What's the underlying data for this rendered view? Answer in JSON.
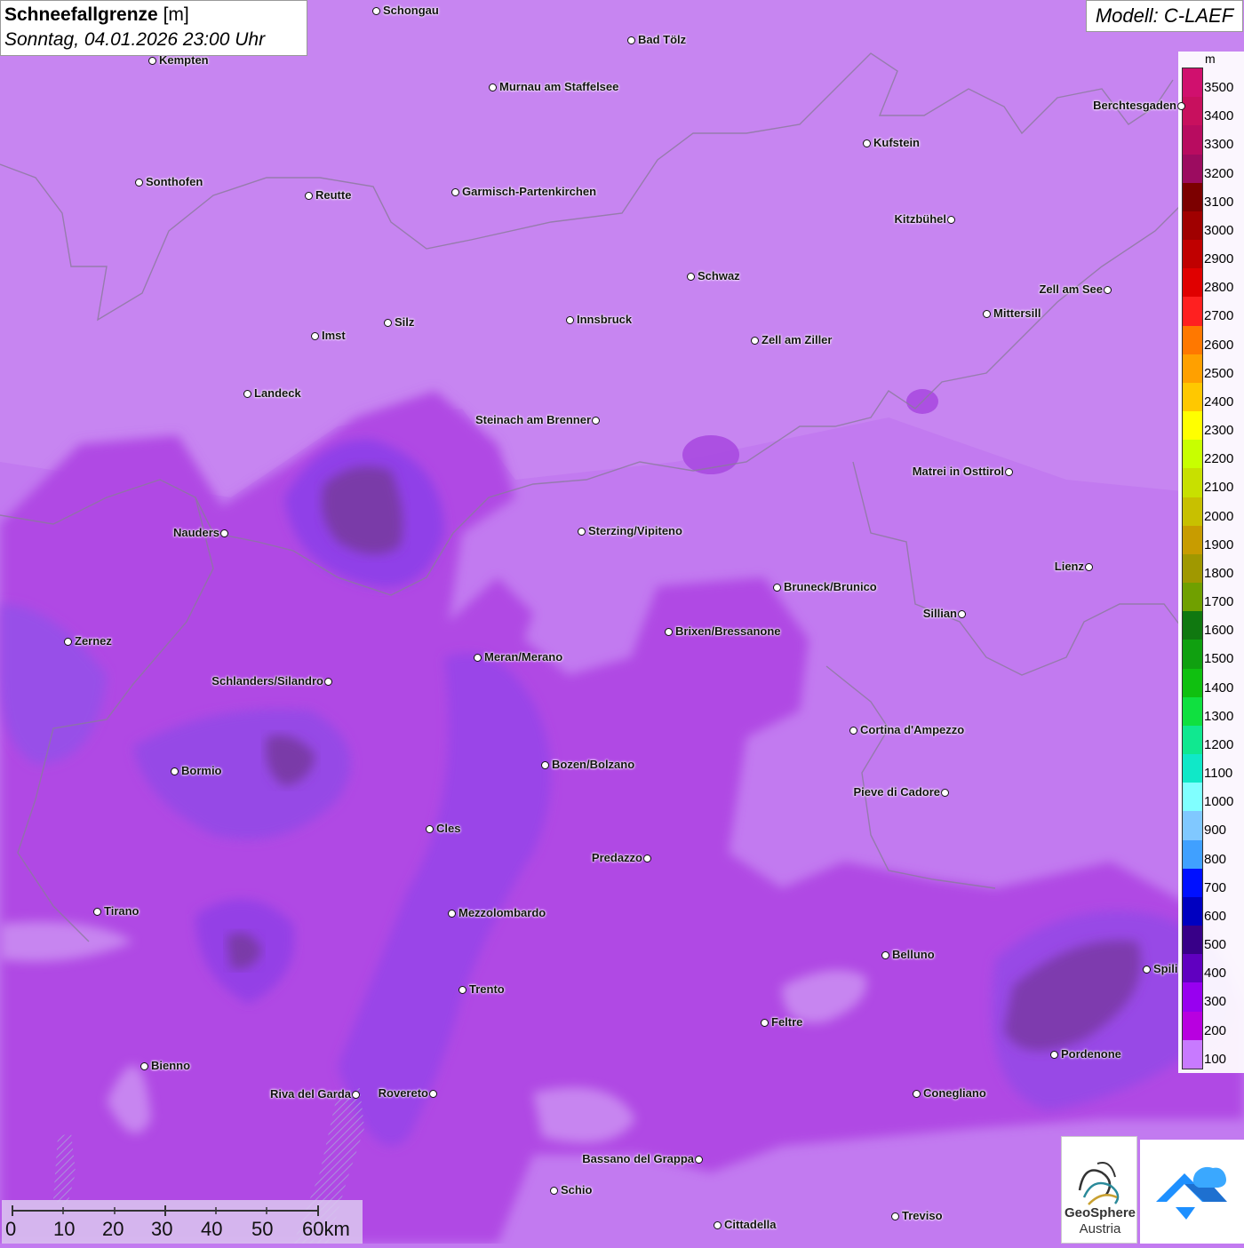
{
  "header": {
    "title_bold": "Schneefallgrenze",
    "title_unit": " [m]",
    "timestamp": "Sonntag, 04.01.2026 23:00 Uhr",
    "model": "Modell: C-LAEF"
  },
  "legend": {
    "unit": "m",
    "steps": [
      {
        "label": "3500",
        "color": "#d0106e"
      },
      {
        "label": "3400",
        "color": "#c8105e"
      },
      {
        "label": "3300",
        "color": "#b80c60"
      },
      {
        "label": "3200",
        "color": "#9c0c60"
      },
      {
        "label": "3100",
        "color": "#7c0000"
      },
      {
        "label": "3000",
        "color": "#a00000"
      },
      {
        "label": "2900",
        "color": "#c00000"
      },
      {
        "label": "2800",
        "color": "#e00000"
      },
      {
        "label": "2700",
        "color": "#ff2020"
      },
      {
        "label": "2600",
        "color": "#ff7800"
      },
      {
        "label": "2500",
        "color": "#ffa000"
      },
      {
        "label": "2400",
        "color": "#ffc800"
      },
      {
        "label": "2300",
        "color": "#ffff00"
      },
      {
        "label": "2200",
        "color": "#c8ff00"
      },
      {
        "label": "2100",
        "color": "#c8e000"
      },
      {
        "label": "2000",
        "color": "#c8c000"
      },
      {
        "label": "1900",
        "color": "#c89c00"
      },
      {
        "label": "1800",
        "color": "#a09800"
      },
      {
        "label": "1700",
        "color": "#70a000"
      },
      {
        "label": "1600",
        "color": "#107810"
      },
      {
        "label": "1500",
        "color": "#10a010"
      },
      {
        "label": "1400",
        "color": "#10c010"
      },
      {
        "label": "1300",
        "color": "#10e040"
      },
      {
        "label": "1200",
        "color": "#10e890"
      },
      {
        "label": "1100",
        "color": "#10e8c8"
      },
      {
        "label": "1000",
        "color": "#80ffff"
      },
      {
        "label": "900",
        "color": "#80c8ff"
      },
      {
        "label": "800",
        "color": "#40a0ff"
      },
      {
        "label": "700",
        "color": "#0010ff"
      },
      {
        "label": "600",
        "color": "#0000c0"
      },
      {
        "label": "500",
        "color": "#380088"
      },
      {
        "label": "400",
        "color": "#6000c0"
      },
      {
        "label": "300",
        "color": "#9800f0"
      },
      {
        "label": "200",
        "color": "#b800e0"
      },
      {
        "label": "100",
        "color": "#c87aff"
      }
    ]
  },
  "cities": [
    {
      "name": "Schongau",
      "side": "right"
    },
    {
      "name": "Bad Tölz",
      "side": "right"
    },
    {
      "name": "Kempten",
      "side": "right"
    },
    {
      "name": "Murnau am Staffelsee",
      "side": "right"
    },
    {
      "name": "Berchtesgaden",
      "side": "left"
    },
    {
      "name": "Kufstein",
      "side": "right"
    },
    {
      "name": "Sonthofen",
      "side": "right"
    },
    {
      "name": "Reutte",
      "side": "right"
    },
    {
      "name": "Garmisch-Partenkirchen",
      "side": "right"
    },
    {
      "name": "Kitzbühel",
      "side": "left"
    },
    {
      "name": "Schwaz",
      "side": "right"
    },
    {
      "name": "Zell am See",
      "side": "left"
    },
    {
      "name": "Mittersill",
      "side": "right"
    },
    {
      "name": "Innsbruck",
      "side": "right"
    },
    {
      "name": "Imst",
      "side": "right"
    },
    {
      "name": "Silz",
      "side": "right"
    },
    {
      "name": "Zell am Ziller",
      "side": "right"
    },
    {
      "name": "Landeck",
      "side": "right"
    },
    {
      "name": "Steinach am Brenner",
      "side": "left"
    },
    {
      "name": "Matrei in Osttirol",
      "side": "left"
    },
    {
      "name": "Nauders",
      "side": "left"
    },
    {
      "name": "Sterzing/Vipiteno",
      "side": "right"
    },
    {
      "name": "Lienz",
      "side": "left"
    },
    {
      "name": "Bruneck/Brunico",
      "side": "right"
    },
    {
      "name": "Sillian",
      "side": "left"
    },
    {
      "name": "Zernez",
      "side": "right"
    },
    {
      "name": "Brixen/Bressanone",
      "side": "right"
    },
    {
      "name": "Meran/Merano",
      "side": "right"
    },
    {
      "name": "Schlanders/Silandro",
      "side": "left"
    },
    {
      "name": "Cortina d'Ampezzo",
      "side": "right"
    },
    {
      "name": "Bozen/Bolzano",
      "side": "right"
    },
    {
      "name": "Bormio",
      "side": "right"
    },
    {
      "name": "Pieve di Cadore",
      "side": "left"
    },
    {
      "name": "Cles",
      "side": "right"
    },
    {
      "name": "Predazzo",
      "side": "left"
    },
    {
      "name": "Tirano",
      "side": "right"
    },
    {
      "name": "Mezzolombardo",
      "side": "right"
    },
    {
      "name": "Belluno",
      "side": "right"
    },
    {
      "name": "Spili",
      "side": "right"
    },
    {
      "name": "Trento",
      "side": "right"
    },
    {
      "name": "Feltre",
      "side": "right"
    },
    {
      "name": "Pordenone",
      "side": "right"
    },
    {
      "name": "Bienno",
      "side": "right"
    },
    {
      "name": "Riva del Garda",
      "side": "left"
    },
    {
      "name": "Rovereto",
      "side": "left"
    },
    {
      "name": "Conegliano",
      "side": "right"
    },
    {
      "name": "Bassano del Grappa",
      "side": "left"
    },
    {
      "name": "Schio",
      "side": "right"
    },
    {
      "name": "Treviso",
      "side": "right"
    },
    {
      "name": "Cittadella",
      "side": "right"
    }
  ],
  "scale": {
    "ticks": [
      "0",
      "10",
      "20",
      "30",
      "40",
      "50",
      "60km"
    ]
  },
  "logos": {
    "org_line1": "GeoSphere",
    "org_line2": "Austria"
  },
  "colors": {
    "base": "#c27af0",
    "mid": "#b452e6",
    "deep": "#9a3cdc",
    "darkest": "#7a38b8",
    "light": "#cc8ef2"
  }
}
